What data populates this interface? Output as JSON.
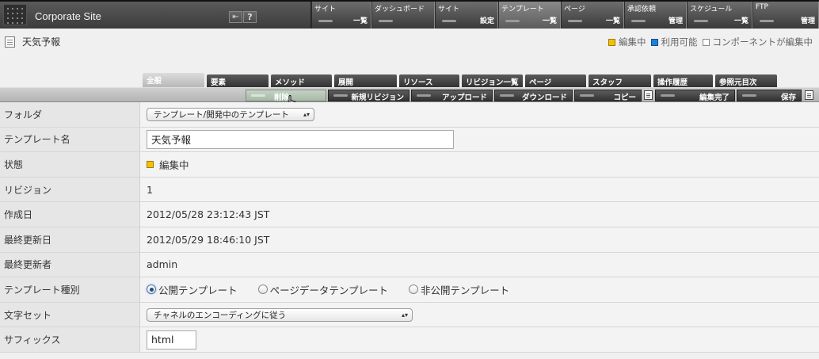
{
  "site": {
    "title": "Corporate Site"
  },
  "topnav": [
    {
      "line1": "サイト",
      "line2": "一覧"
    },
    {
      "line1": "ダッシュボード",
      "line2": ""
    },
    {
      "line1": "サイト",
      "line2": "設定"
    },
    {
      "line1": "テンプレート",
      "line2": "一覧"
    },
    {
      "line1": "ページ",
      "line2": "一覧"
    },
    {
      "line1": "承認依頼",
      "line2": "管理"
    },
    {
      "line1": "スケジュール",
      "line2": "一覧"
    },
    {
      "line1": "FTP",
      "line2": "管理"
    }
  ],
  "page": {
    "name": "天気予報"
  },
  "legend": {
    "editing": "編集中",
    "available": "利用可能",
    "component_editing": "コンポーネントが編集中",
    "colors": {
      "editing": "#f2c200",
      "available": "#1f7fd6",
      "component": "#ffffff"
    }
  },
  "tabs": [
    "全般",
    "要素",
    "メソッド",
    "展開",
    "リソース",
    "リビジョン一覧",
    "ページ",
    "スタッフ",
    "操作履歴",
    "参照元目次"
  ],
  "actions": {
    "delete": "削除",
    "new_revision": "新規リビジョン",
    "upload": "アップロード",
    "download": "ダウンロード",
    "copy": "コピー",
    "finish_edit": "編集完了",
    "save": "保存"
  },
  "form": {
    "folder": {
      "label": "フォルダ",
      "value": "テンプレート/開発中のテンプレート"
    },
    "template_name": {
      "label": "テンプレート名",
      "value": "天気予報"
    },
    "status": {
      "label": "状態",
      "value": "編集中"
    },
    "revision": {
      "label": "リビジョン",
      "value": "1"
    },
    "created": {
      "label": "作成日",
      "value": "2012/05/28 23:12:43 JST"
    },
    "updated": {
      "label": "最終更新日",
      "value": "2012/05/29 18:46:10 JST"
    },
    "updated_by": {
      "label": "最終更新者",
      "value": "admin"
    },
    "template_type": {
      "label": "テンプレート種別",
      "options": [
        "公開テンプレート",
        "ページデータテンプレート",
        "非公開テンプレート"
      ],
      "selected": "公開テンプレート"
    },
    "charset": {
      "label": "文字セット",
      "value": "チャネルのエンコーディングに従う"
    },
    "suffix": {
      "label": "サフィックス",
      "value": "html"
    }
  }
}
